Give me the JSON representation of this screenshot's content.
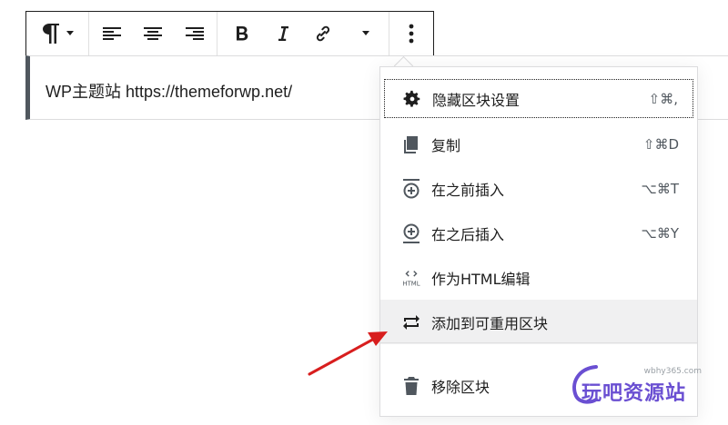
{
  "toolbar": {
    "groups": [
      {
        "name": "block-type",
        "buttons": [
          "paragraph-icon",
          "chevron-down-icon"
        ]
      },
      {
        "name": "alignment",
        "buttons": [
          "align-left-icon",
          "align-center-icon",
          "align-right-icon"
        ]
      },
      {
        "name": "formatting",
        "buttons": [
          "bold-icon",
          "italic-icon",
          "link-icon",
          "chevron-down-icon"
        ]
      },
      {
        "name": "more",
        "buttons": [
          "more-vertical-icon"
        ]
      }
    ]
  },
  "block": {
    "text": "WP主题站 https://themeforwp.net/"
  },
  "menu": {
    "items": [
      {
        "label": "隐藏区块设置",
        "shortcut": "⇧⌘,",
        "icon": "gear-icon",
        "state": "focused"
      },
      {
        "label": "复制",
        "shortcut": "⇧⌘D",
        "icon": "duplicate-icon",
        "state": "normal"
      },
      {
        "label": "在之前插入",
        "shortcut": "⌥⌘T",
        "icon": "insert-before-icon",
        "state": "normal"
      },
      {
        "label": "在之后插入",
        "shortcut": "⌥⌘Y",
        "icon": "insert-after-icon",
        "state": "normal"
      },
      {
        "label": "作为HTML编辑",
        "shortcut": "",
        "icon": "html-icon",
        "state": "normal"
      },
      {
        "label": "添加到可重用区块",
        "shortcut": "",
        "icon": "reusable-block-icon",
        "state": "hovered"
      },
      {
        "label": "移除区块",
        "shortcut": "",
        "icon": "trash-icon",
        "state": "normal"
      }
    ],
    "html_icon_text": "HTML"
  },
  "watermark": {
    "url": "wbhy365.com",
    "text": "玩吧资源站"
  },
  "colors": {
    "text": "#1e1e1e",
    "border": "#dcdcde",
    "hover_bg": "#f0f0f1",
    "arrow": "#d81e1e",
    "watermark": "#6a4fd2"
  }
}
